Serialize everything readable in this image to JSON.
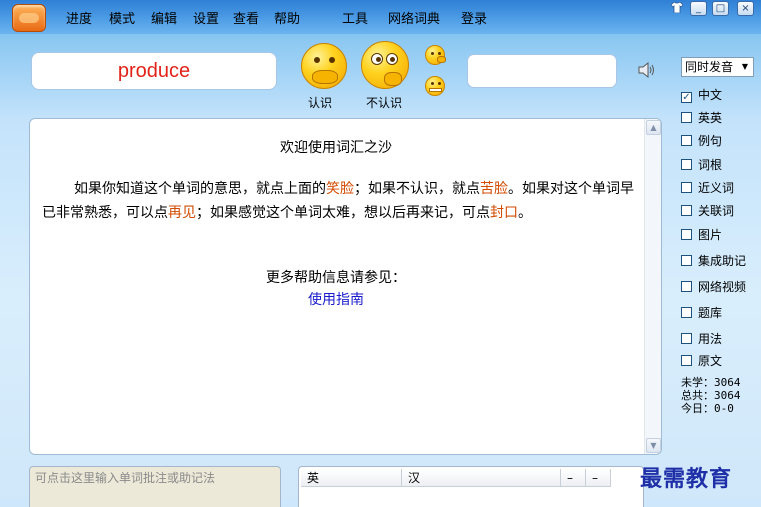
{
  "menu": [
    "进度",
    "模式",
    "编辑",
    "设置",
    "查看",
    "帮助",
    "工具",
    "网络词典",
    "登录"
  ],
  "window_buttons": [
    "_",
    "□",
    "×"
  ],
  "word": "produce",
  "faces": {
    "know_label": "认识",
    "dont_know_label": "不认识"
  },
  "pronunciation_select": "同时发音",
  "content": {
    "title": "欢迎使用词汇之沙",
    "para_1": "如果你知道这个单词的意思，就点上面的",
    "smile": "笑脸",
    "para_2": "；如果不认识，就点",
    "bitter": "苦脸",
    "para_3": "。如果对这个单词早已非常熟悉，可以点",
    "again": "再见",
    "para_4": "；如果感觉这个单词太难，想以后再来记，可点",
    "seal": "封口",
    "para_5": "。",
    "more": "更多帮助信息请参见：",
    "guide": "使用指南"
  },
  "options": [
    {
      "label": "中文",
      "checked": true
    },
    {
      "label": "英英",
      "checked": false
    },
    {
      "label": "例句",
      "checked": false
    },
    {
      "label": "词根",
      "checked": false
    },
    {
      "label": "近义词",
      "checked": false
    },
    {
      "label": "关联词",
      "checked": false
    },
    {
      "label": "图片",
      "checked": false
    },
    {
      "label": "集成助记",
      "checked": false
    },
    {
      "label": "网络视频",
      "checked": false
    },
    {
      "label": "题库",
      "checked": false
    },
    {
      "label": "用法",
      "checked": false
    },
    {
      "label": "原文",
      "checked": false
    }
  ],
  "stats": {
    "unlearned": "未学：3064",
    "total": "总共：3064",
    "today": "今日：0-0"
  },
  "note_placeholder": "可点击这里输入单词批注或助记法",
  "table_headers": [
    "英",
    "汉",
    "–",
    "–"
  ],
  "watermark": "最需教育",
  "colors": {
    "word": "#e2231a",
    "highlight": "#d24b00",
    "link": "#1a1acc"
  }
}
